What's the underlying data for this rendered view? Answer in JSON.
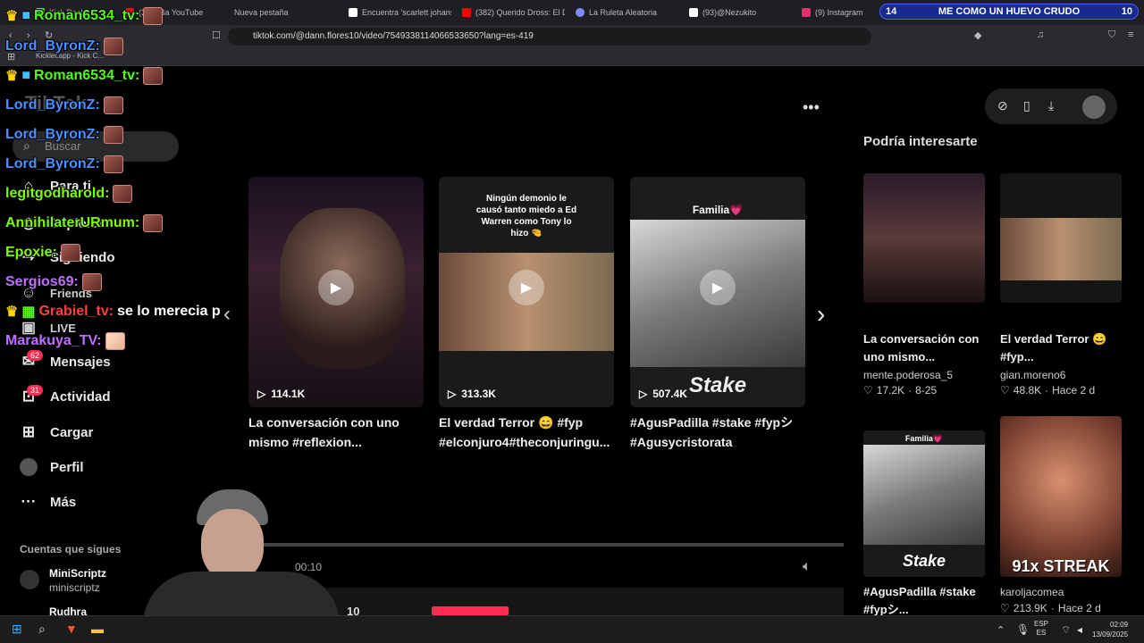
{
  "browser": {
    "tabs": [
      {
        "label": "Kick Dashbo",
        "color": "#53fc18"
      },
      {
        "label": "(382) Ba  YouTube",
        "color": "#ff0000"
      },
      {
        "label": "Nueva pestaña",
        "color": "#888888"
      },
      {
        "label": "Encuentra 'scarlett johans",
        "color": "#ffffff"
      },
      {
        "label": "(382) Querido Dross: El D",
        "color": "#ff0000"
      },
      {
        "label": "La Ruleta Aleatoria",
        "color": "#7c8cff"
      },
      {
        "label": "(93)@Nezukito",
        "color": "#ffffff"
      },
      {
        "label": "(9) Instagram",
        "color": "#e1306c"
      }
    ],
    "url": "tiktok.com/@dann.flores10/video/7549338114066533650?lang=es-419",
    "bookmark": "Kicklet.app - Kick C..."
  },
  "kick_banner": {
    "left_num": "14",
    "text": "ME COMO UN HUEVO CRUDO",
    "right_num": "10"
  },
  "tiktok": {
    "logo": "TikTok",
    "search_placeholder": "Buscar",
    "nav": [
      {
        "label": "Para ti",
        "icon": "home-icon"
      },
      {
        "label": "Explorar",
        "icon": "compass-icon"
      },
      {
        "label": "Siguiendo",
        "icon": "following-icon"
      },
      {
        "label": "Friends",
        "icon": "friends-icon"
      },
      {
        "label": "LIVE",
        "icon": "live-icon"
      },
      {
        "label": "Mensajes",
        "icon": "inbox-icon",
        "badge": "62"
      },
      {
        "label": "Actividad",
        "icon": "activity-icon",
        "badge": "31"
      },
      {
        "label": "Cargar",
        "icon": "upload-icon"
      },
      {
        "label": "Perfil",
        "icon": "avatar-icon"
      },
      {
        "label": "Más",
        "icon": "more-icon"
      }
    ],
    "following_header": "Cuentas que sigues",
    "following": [
      {
        "name": "MiniScriptz",
        "handle": "miniscriptz"
      },
      {
        "name": "Rudhra",
        "handle": ""
      }
    ],
    "videos": [
      {
        "views": "114.1K",
        "caption": "La conversación con uno mismo #reflexion...",
        "overlay": ""
      },
      {
        "views": "313.3K",
        "caption": "El verdad Terror 😄 #fyp #elconjuro4#theconjuringu...",
        "overlay": "Ningún demonio le causó tanto miedo a Ed Warren como Tony lo hizo 🤏"
      },
      {
        "views": "507.4K",
        "caption": "#AgusPadilla #stake #fypシ #Agusycristorata",
        "overlay": "Familia💗",
        "brand": "Stake"
      }
    ],
    "player": {
      "time": "00:10",
      "counter": "10"
    },
    "recommended_header": "Podría interesarte",
    "recommended": [
      {
        "title": "La conversación con uno mismo...",
        "author": "mente.poderosa_5",
        "likes": "17.2K",
        "date": "8-25"
      },
      {
        "title": "El verdad Terror 😄 #fyp...",
        "author": "gian.moreno6",
        "likes": "48.8K",
        "date": "Hace 2 d"
      },
      {
        "title": "#AgusPadilla #stake #fypシ...",
        "author": "",
        "likes": "",
        "date": "",
        "brand": "Stake",
        "overlay": "Familia💗"
      },
      {
        "title": "",
        "author": "karoljacomea",
        "likes": "213.9K",
        "date": "Hace 2 d",
        "overlay": "91x STREAK"
      }
    ]
  },
  "chat": [
    {
      "user": "Roman6534_tv:",
      "color": "#53fc18",
      "msg": "",
      "crown": true
    },
    {
      "user": "Lord_ByronZ:",
      "color": "#4a90ff",
      "msg": ""
    },
    {
      "user": "Roman6534_tv:",
      "color": "#53fc18",
      "msg": "",
      "crown": true
    },
    {
      "user": "Lord_ByronZ:",
      "color": "#4a90ff",
      "msg": ""
    },
    {
      "user": "Lord_ByronZ:",
      "color": "#4a90ff",
      "msg": ""
    },
    {
      "user": "Lord_ByronZ:",
      "color": "#4a90ff",
      "msg": ""
    },
    {
      "user": "legitgodharold:",
      "color": "#7cfc00",
      "msg": ""
    },
    {
      "user": "AnnihilaterURmum:",
      "color": "#7cfc00",
      "msg": ""
    },
    {
      "user": "Epoxie:",
      "color": "#7cfc00",
      "msg": ""
    },
    {
      "user": "Sergios69:",
      "color": "#c070ff",
      "msg": ""
    },
    {
      "user": "Grabiel_tv:",
      "color": "#ff4040",
      "msg": "se lo merecia p",
      "crown": true
    },
    {
      "user": "Marakuya_TV:",
      "color": "#c070ff",
      "msg": ""
    }
  ],
  "taskbar": {
    "lang": "ESP",
    "lang2": "ES",
    "time": "02:09",
    "date": "13/09/2025"
  }
}
